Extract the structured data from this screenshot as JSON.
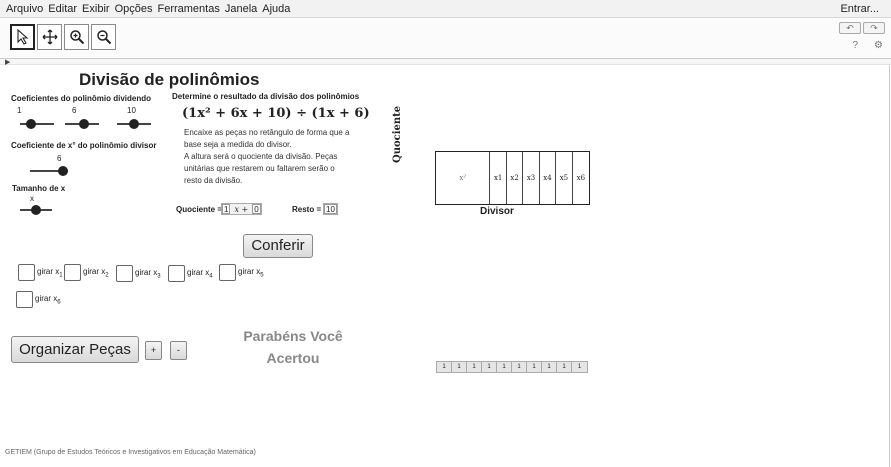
{
  "menu": {
    "items": [
      "Arquivo",
      "Editar",
      "Exibir",
      "Opções",
      "Ferramentas",
      "Janela",
      "Ajuda"
    ],
    "login": "Entrar..."
  },
  "toolbar": {
    "tools": [
      {
        "name": "move-tool",
        "icon": "arrow-pointer-icon",
        "selected": true
      },
      {
        "name": "move-view-tool",
        "icon": "move-cross-icon",
        "selected": false
      },
      {
        "name": "zoom-in-tool",
        "icon": "zoom-in-icon",
        "selected": false
      },
      {
        "name": "zoom-out-tool",
        "icon": "zoom-out-icon",
        "selected": false
      }
    ],
    "undo": "↶",
    "redo": "↷",
    "help": "?",
    "settings": "⚙"
  },
  "applet": {
    "title": "Divisão de polinômios",
    "dividend_label": "Coeficientes do polinômio dividendo",
    "dividend_values": [
      "1",
      "6",
      "10"
    ],
    "divisor_label": "Coeficiente de x° do polinômio divisor",
    "divisor_value": "6",
    "size_label": "Tamanho de x",
    "size_var": "x",
    "task_heading": "Determine o resultado da divisão dos polinômios",
    "formula": "(1x² + 6x + 10) ÷ (1x + 6)",
    "instructions": [
      "Encaixe as peças no retângulo de forma que a",
      "base seja a medida do divisor.",
      "A altura será o quociente da divisão. Peças",
      "unitárias que restarem ou faltarem serão o",
      "resto da divisão."
    ],
    "quotient_label": "Quociente =",
    "quotient_coef": "1",
    "quotient_mid": "x +",
    "quotient_const": "0",
    "remainder_label": "Resto =",
    "remainder_value": "10",
    "check_button": "Conferir",
    "rotate_label": "girar x",
    "rotate_subs": [
      "1",
      "2",
      "3",
      "4",
      "5",
      "6"
    ],
    "organize_button": "Organizar Peças",
    "plus_button": "+",
    "minus_button": "-",
    "congrats_line1": "Parabéns  Você",
    "congrats_line2": "Acertou",
    "footer": "GETIEM (Grupo de Estudos Teóricos e Investigativos em Educação Matemática)"
  },
  "geometry": {
    "quotient_axis_label": "Quociente",
    "divisor_axis_label": "Divisor",
    "big_piece_label": "x²",
    "x_pieces": [
      "x1",
      "x2",
      "x3",
      "x4",
      "x5",
      "x6"
    ],
    "unit_pieces": [
      "1",
      "1",
      "1",
      "1",
      "1",
      "1",
      "1",
      "1",
      "1",
      "1"
    ]
  },
  "sliders": {
    "dividend_a_level": 0.25,
    "dividend_b_level": 0.6,
    "dividend_c_level": 0.5,
    "divisor_level": 1.0,
    "size_level": 0.5
  }
}
